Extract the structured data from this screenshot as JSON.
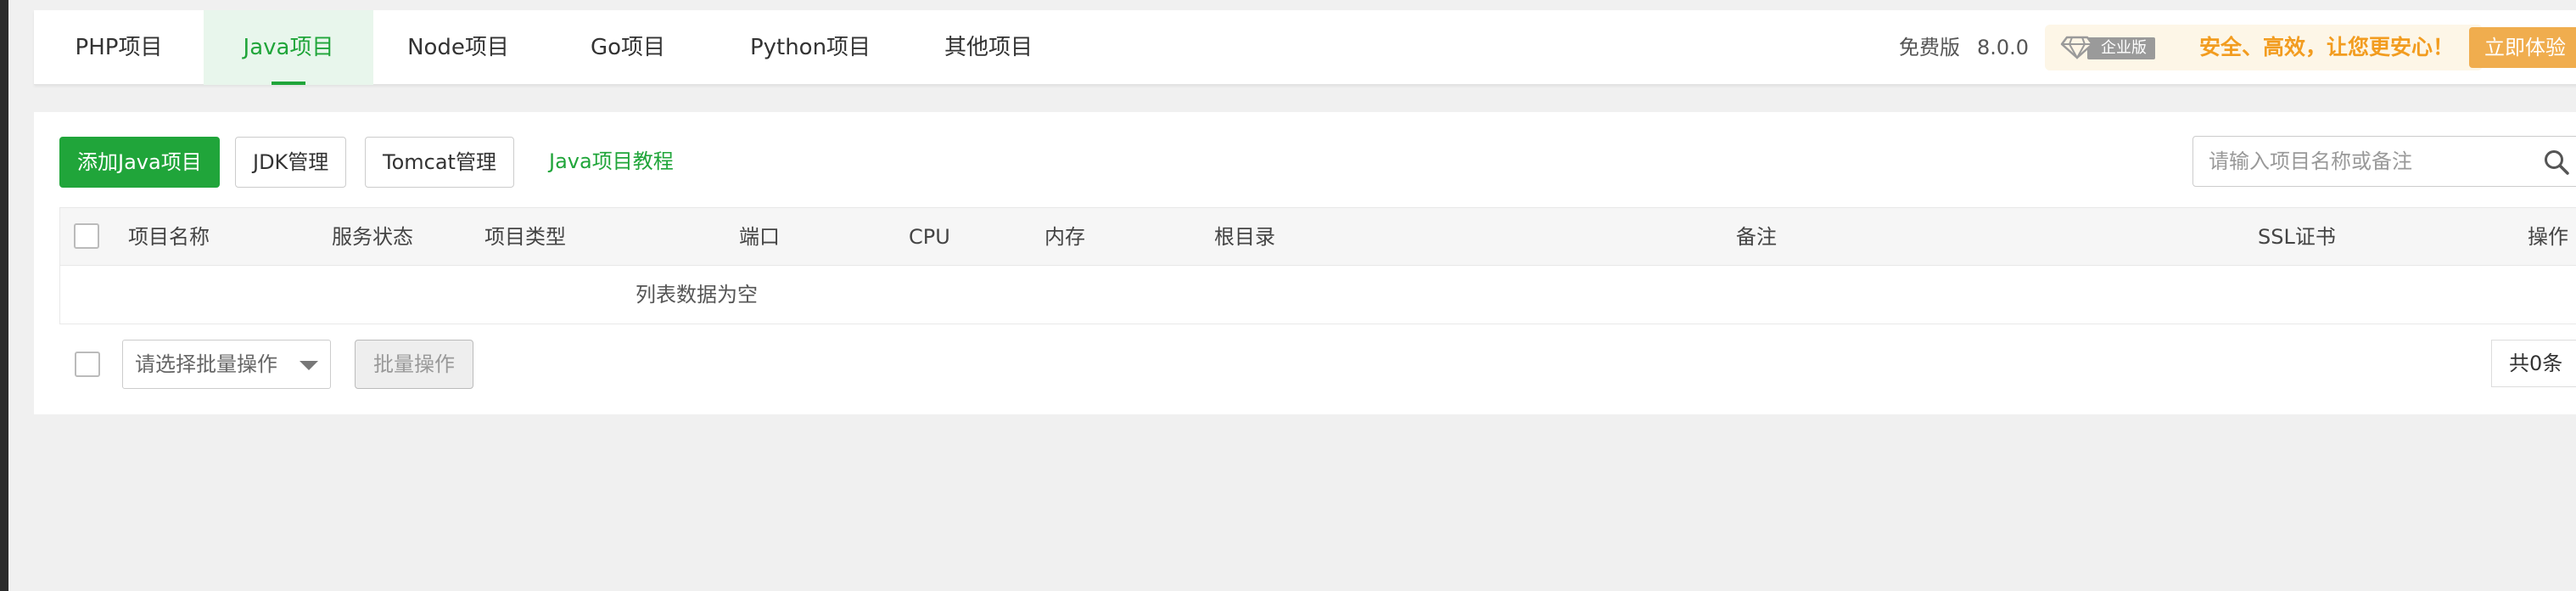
{
  "tabs": [
    {
      "label": "PHP项目",
      "active": false
    },
    {
      "label": "Java项目",
      "active": true
    },
    {
      "label": "Node项目",
      "active": false
    },
    {
      "label": "Go项目",
      "active": false
    },
    {
      "label": "Python项目",
      "active": false
    },
    {
      "label": "其他项目",
      "active": false
    }
  ],
  "header": {
    "edition": "免费版",
    "version": "8.0.0",
    "enterprise_badge": "企业版",
    "promo_text": "安全、高效，让您更安心！",
    "try_button": "立即体验"
  },
  "toolbar": {
    "add_button": "添加Java项目",
    "jdk_button": "JDK管理",
    "tomcat_button": "Tomcat管理",
    "tutorial_link": "Java项目教程",
    "search_placeholder": "请输入项目名称或备注"
  },
  "table": {
    "columns": [
      "项目名称",
      "服务状态",
      "项目类型",
      "端口",
      "CPU",
      "内存",
      "根目录",
      "备注",
      "SSL证书",
      "操作"
    ],
    "empty_text": "列表数据为空"
  },
  "footer": {
    "batch_select_placeholder": "请选择批量操作",
    "batch_button": "批量操作",
    "total": "共0条"
  },
  "colors": {
    "accent_green": "#20a53a",
    "promo_orange": "#f29c1f",
    "try_button_bg": "#f0ad4e"
  }
}
